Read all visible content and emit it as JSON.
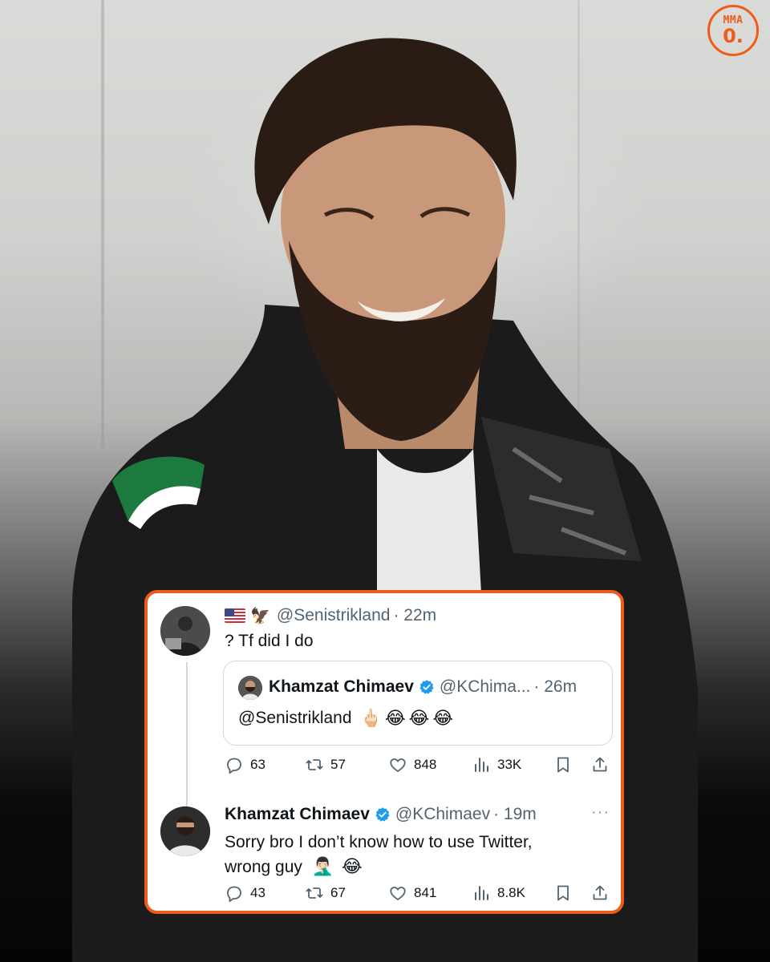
{
  "logo": {
    "top": "MMA",
    "bottom": "0."
  },
  "tweet1": {
    "flag_emoji": "🇺🇸",
    "eagle_emoji": "🦅",
    "handle": "@Senistrikland",
    "time": "· 22m",
    "text": "? Tf did I do",
    "quote": {
      "name": "Khamzat Chimaev",
      "handle": "@KChima...",
      "time": "· 26m",
      "text": "@Senistrikland",
      "emojis": [
        "🖕🏻",
        "😂",
        "😂",
        "😂"
      ]
    },
    "actions": {
      "replies": "63",
      "reposts": "57",
      "likes": "848",
      "views": "33K"
    }
  },
  "tweet2": {
    "name": "Khamzat Chimaev",
    "handle": "@KChimaev",
    "time": "· 19m",
    "more": "···",
    "text_line1": "Sorry bro I don’t know how to use Twitter,",
    "text_line2": "wrong guy",
    "emojis": [
      "🤦🏻‍♂️",
      "😂"
    ],
    "actions": {
      "replies": "43",
      "reposts": "67",
      "likes": "841",
      "views": "8.8K"
    }
  },
  "colors": {
    "accent": "#f05a1a",
    "verified": "#1d9bf0",
    "muted": "#536471"
  },
  "icons": [
    "reply-icon",
    "repost-icon",
    "like-icon",
    "views-icon",
    "bookmark-icon",
    "share-icon",
    "verified-badge-icon",
    "more-icon"
  ]
}
